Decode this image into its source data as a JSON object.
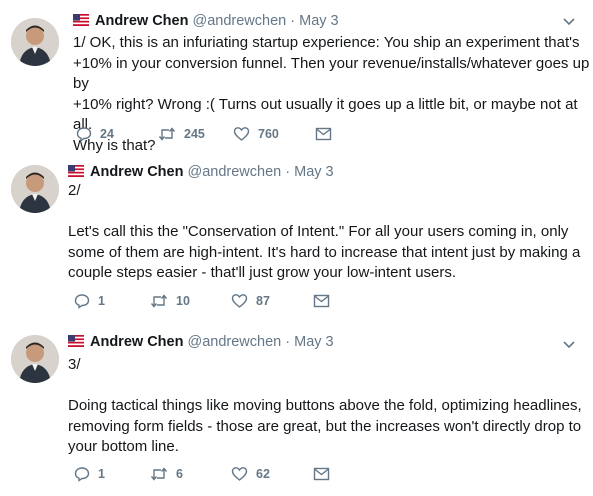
{
  "tweets": [
    {
      "flag_icon": "us-flag-icon",
      "name": "Andrew Chen",
      "handle": "@andrewchen",
      "separator": "·",
      "date": "May 3",
      "text": "1/ OK, this is an infuriating startup experience: You ship an experiment that's\n+10% in your conversion funnel. Then your revenue/installs/whatever goes up by\n+10% right? Wrong :( Turns out usually it goes up a little bit, or maybe not at all.\nWhy is that?",
      "replies": "24",
      "retweets": "245",
      "likes": "760"
    },
    {
      "flag_icon": "us-flag-icon",
      "name": "Andrew Chen",
      "handle": "@andrewchen",
      "separator": "·",
      "date": "May 3",
      "text": "2/\n\nLet's call this the \"Conservation of Intent.\" For all your users coming in, only\nsome of them are high-intent. It's hard to increase that intent just by making a\ncouple steps easier - that'll just grow your low-intent users.",
      "replies": "1",
      "retweets": "10",
      "likes": "87"
    },
    {
      "flag_icon": "us-flag-icon",
      "name": "Andrew Chen",
      "handle": "@andrewchen",
      "separator": "·",
      "date": "May 3",
      "text": "3/\n\nDoing tactical things like moving buttons above the fold, optimizing headlines,\nremoving form fields - those are great, but the increases won't directly drop to\nyour bottom line.",
      "replies": "1",
      "retweets": "6",
      "likes": "62"
    }
  ],
  "colors": {
    "text": "#14171a",
    "muted": "#657786",
    "background": "#ffffff"
  },
  "icons": [
    "reply-icon",
    "retweet-icon",
    "like-icon",
    "direct-message-icon",
    "chevron-down-icon",
    "us-flag-icon"
  ]
}
